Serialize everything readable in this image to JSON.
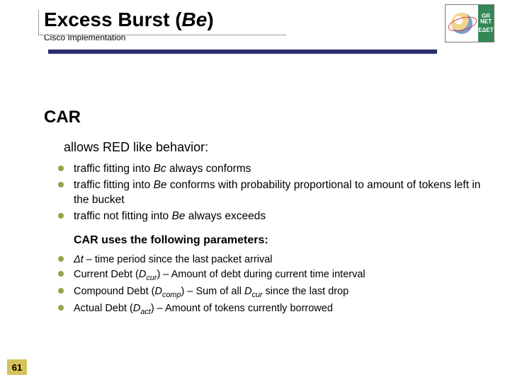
{
  "header": {
    "title_main": "Excess Burst (",
    "title_be": "Be",
    "title_close": ")",
    "subtitle": "Cisco Implementation"
  },
  "logo": {
    "text_top": "GR",
    "text_mid": "NET",
    "text_bot": "ΕΔΕΤ"
  },
  "section": "CAR",
  "intro": "allows RED like behavior:",
  "bullets": [
    {
      "pre": "traffic fitting into ",
      "sym": "Bc",
      "post": " always conforms"
    },
    {
      "pre": "traffic fitting into ",
      "sym": "Be",
      "post": " conforms with probability  proportional to amount of tokens left in the bucket"
    },
    {
      "pre": "traffic not fitting into ",
      "sym": "Be",
      "post": " always exceeds"
    }
  ],
  "subhead": "CAR uses the following parameters:",
  "params": [
    {
      "sym": "Δt",
      "sub": "",
      "post": " – time period since the last packet arrival"
    },
    {
      "pre": "Current Debt (",
      "sym": "D",
      "sub": "cur",
      "post": ") – Amount of debt during current time interval"
    },
    {
      "pre": "Compound Debt (",
      "sym": "D",
      "sub": "comp",
      "post_a": ") – Sum of all ",
      "sym2": "D",
      "sub2": "cur",
      "post_b": " since the last drop"
    },
    {
      "pre": "Actual Debt (",
      "sym": "D",
      "sub": "act",
      "post": ") –  Amount of tokens currently borrowed"
    }
  ],
  "page": "61"
}
